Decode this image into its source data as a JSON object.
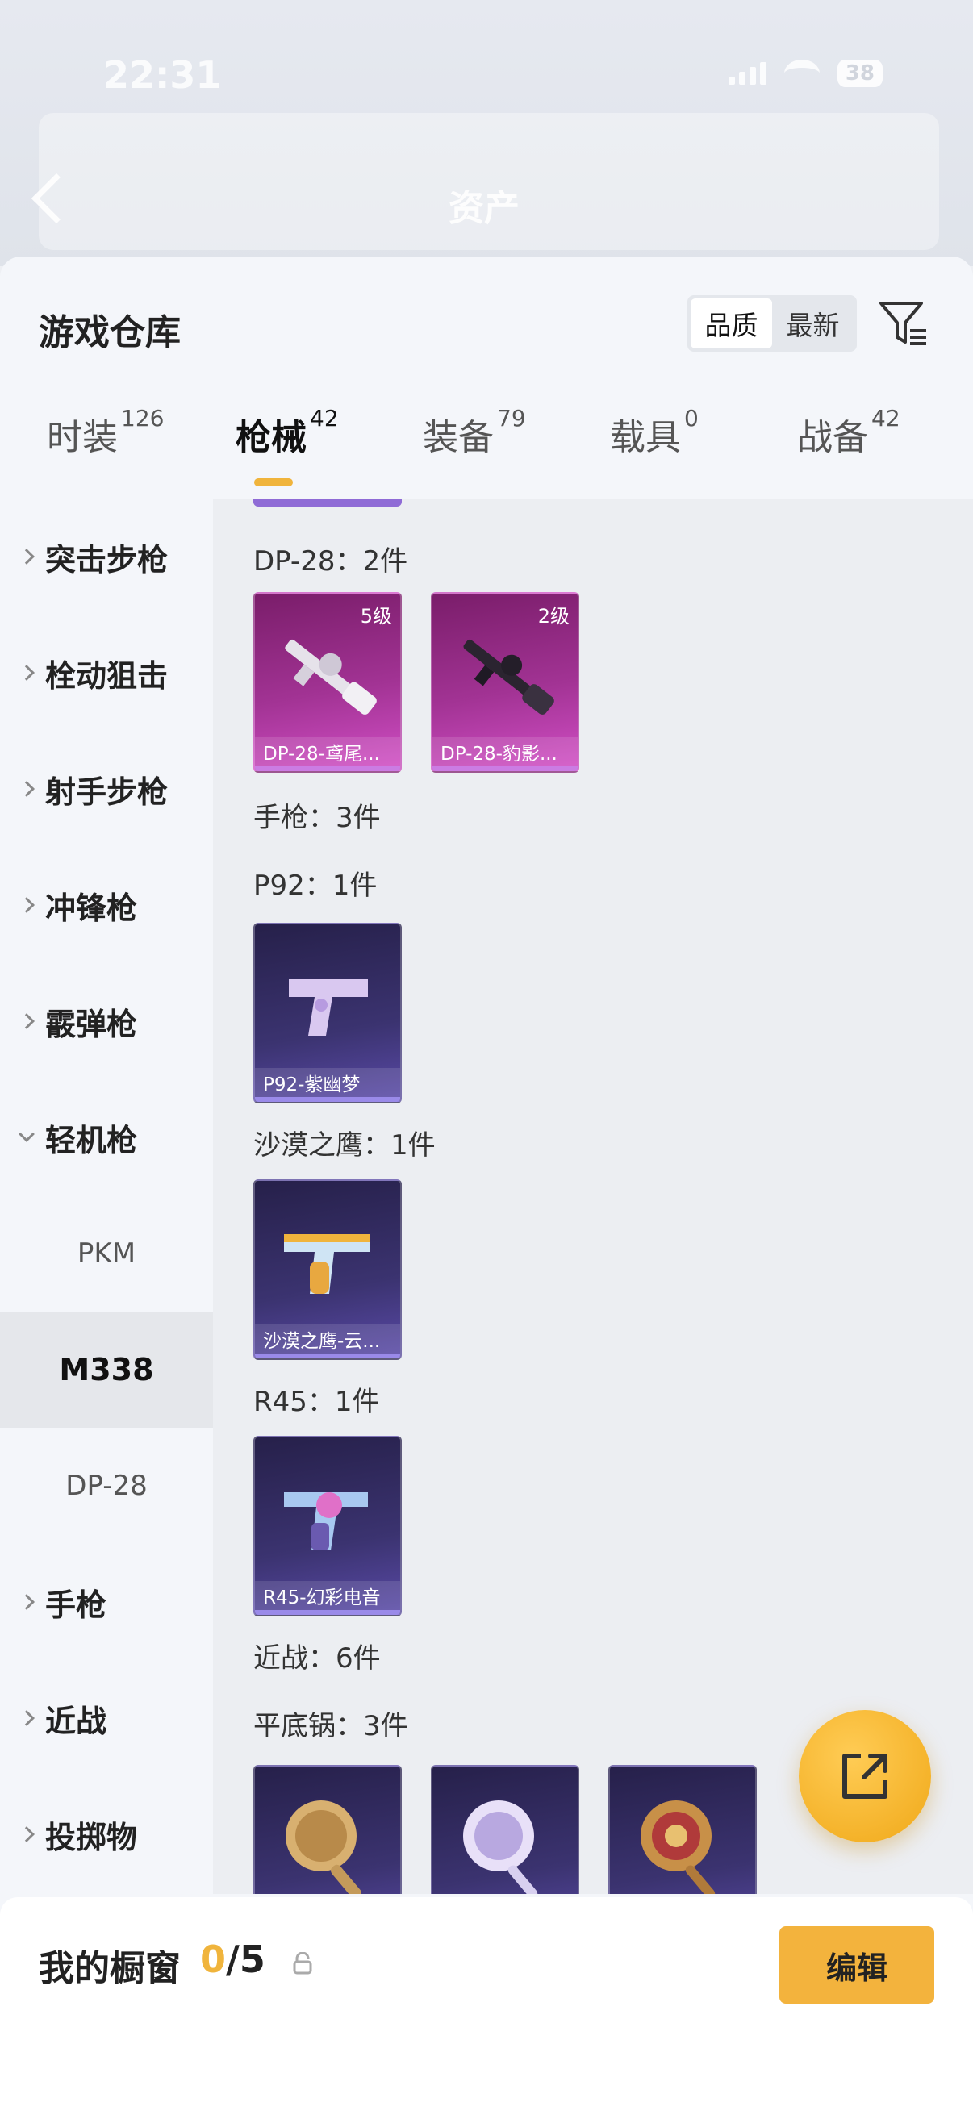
{
  "status": {
    "time": "22:31",
    "battery": "38"
  },
  "header": {
    "title": "资产"
  },
  "sheet": {
    "title": "游戏仓库",
    "sort_options": [
      "品质",
      "最新"
    ],
    "tabs": [
      {
        "label": "时装",
        "count": "126"
      },
      {
        "label": "枪械",
        "count": "42"
      },
      {
        "label": "装备",
        "count": "79"
      },
      {
        "label": "载具",
        "count": "0"
      },
      {
        "label": "战备",
        "count": "42"
      }
    ]
  },
  "sidebar": {
    "categories": [
      "突击步枪",
      "栓动狙击",
      "射手步枪",
      "冲锋枪",
      "霰弹枪",
      "轻机枪",
      "手枪",
      "近战",
      "投掷物"
    ],
    "subitems": [
      "PKM",
      "M338",
      "DP-28"
    ]
  },
  "content": {
    "dp28_label": "DP-28：2件",
    "dp28_items": [
      {
        "level": "5级",
        "name": "DP-28-鸢尾..."
      },
      {
        "level": "2级",
        "name": "DP-28-豹影..."
      }
    ],
    "pistol_label": "手枪：3件",
    "p92_label": "P92：1件",
    "p92_item": "P92-紫幽梦",
    "deagle_label": "沙漠之鹰：1件",
    "deagle_item": "沙漠之鹰-云...",
    "r45_label": "R45：1件",
    "r45_item": "R45-幻彩电音",
    "melee_label": "近战：6件",
    "pan_label": "平底锅：3件"
  },
  "bottom": {
    "label": "我的橱窗",
    "current": "0",
    "total": "/5",
    "edit": "编辑"
  },
  "colors": {
    "accent": "#f3b33d",
    "purple_rarity": "#a23394",
    "blue_rarity": "#3b3370"
  }
}
